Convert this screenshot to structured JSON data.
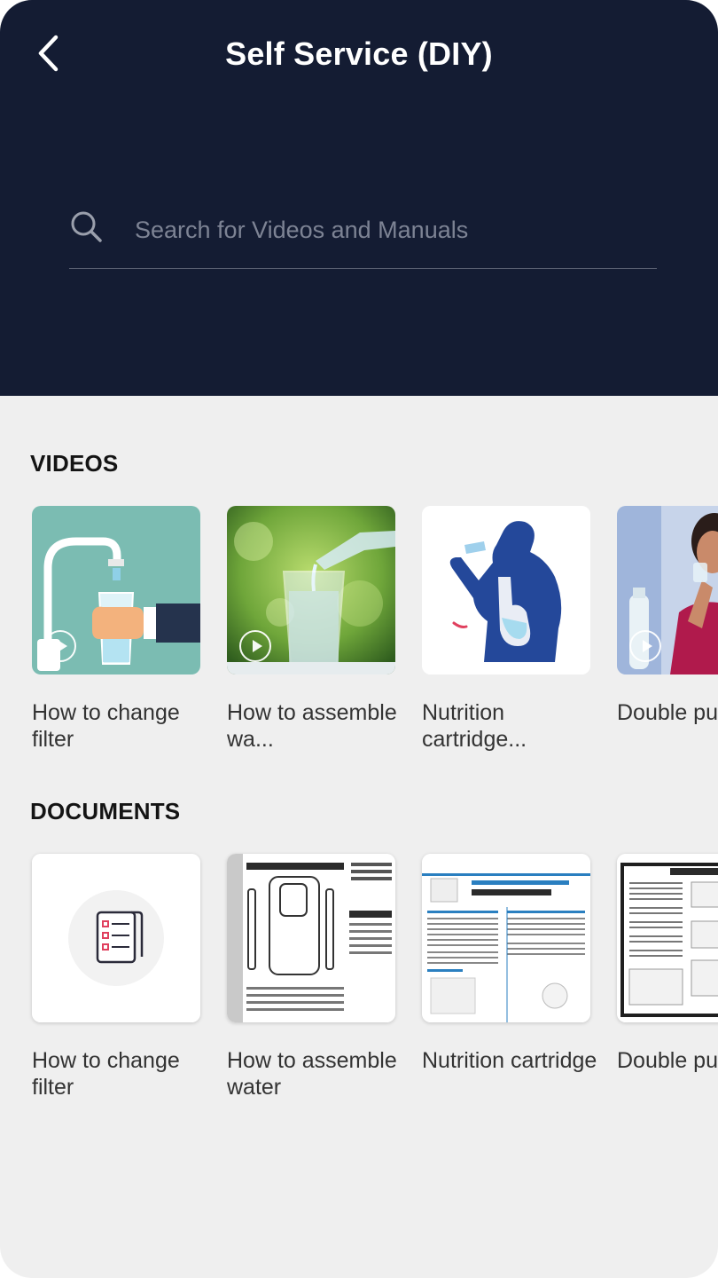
{
  "header": {
    "title": "Self Service (DIY)",
    "back_icon": "chevron-left-icon"
  },
  "search": {
    "placeholder": "Search for Videos and Manuals",
    "value": "",
    "icon": "search-icon"
  },
  "videos": {
    "title": "VIDEOS",
    "items": [
      {
        "label": "How to change filter",
        "thumbnail": "faucet-glass-illustration"
      },
      {
        "label": "How to assemble wa...",
        "thumbnail": "water-pouring-photo"
      },
      {
        "label": "Nutrition cartridge...",
        "thumbnail": "person-drinking-illustration"
      },
      {
        "label": "Double purificatio",
        "thumbnail": "woman-drinking-photo"
      }
    ]
  },
  "documents": {
    "title": "DOCUMENTS",
    "items": [
      {
        "label": "How to change filter",
        "thumbnail": "checklist-icon"
      },
      {
        "label": "How to assemble water",
        "thumbnail": "manual-page-keys-and-parts"
      },
      {
        "label": "Nutrition cartridge",
        "thumbnail": "manual-page-quick-start-guide"
      },
      {
        "label": "Double purificatio",
        "thumbnail": "manual-page-operation-guide"
      }
    ]
  },
  "colors": {
    "header_bg": "#141c33",
    "page_bg": "#efefef",
    "accent_red": "#e0405e"
  }
}
